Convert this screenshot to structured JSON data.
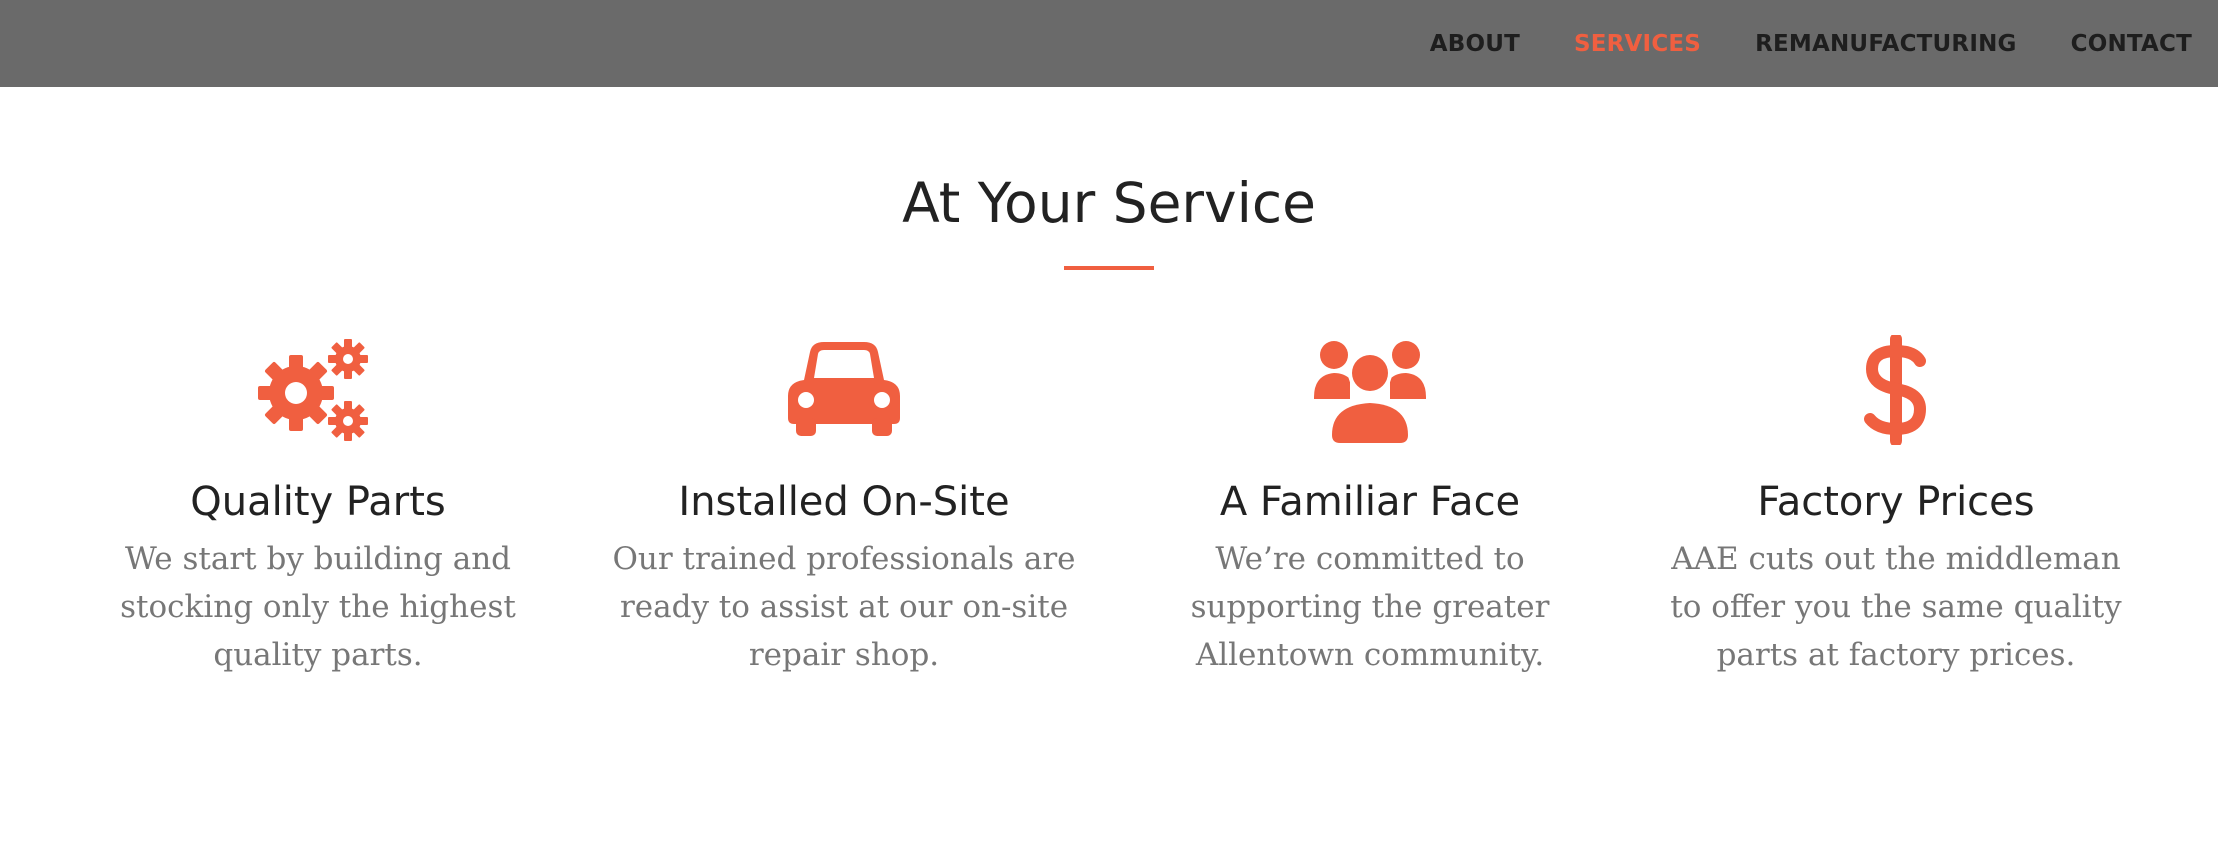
{
  "nav": {
    "items": [
      {
        "label": "ABOUT"
      },
      {
        "label": "SERVICES"
      },
      {
        "label": "REMANUFACTURING"
      },
      {
        "label": "CONTACT"
      }
    ],
    "active_index": 1
  },
  "section": {
    "title": "At Your Service"
  },
  "features": [
    {
      "icon": "gears-icon",
      "title": "Quality Parts",
      "text": "We start by building and stocking only the highest quality parts."
    },
    {
      "icon": "car-icon",
      "title": "Installed On-Site",
      "text": "Our trained professionals are ready to assist at our on-site repair shop."
    },
    {
      "icon": "users-icon",
      "title": "A Familiar Face",
      "text": "We’re committed to supporting the greater Allentown community."
    },
    {
      "icon": "dollar-icon",
      "title": "Factory Prices",
      "text": "AAE cuts out the middleman to offer you the same quality parts at factory prices."
    }
  ],
  "colors": {
    "accent": "#f05f40",
    "navbar_bg": "#6a6a6a",
    "heading": "#222222",
    "body_text": "#777777"
  }
}
